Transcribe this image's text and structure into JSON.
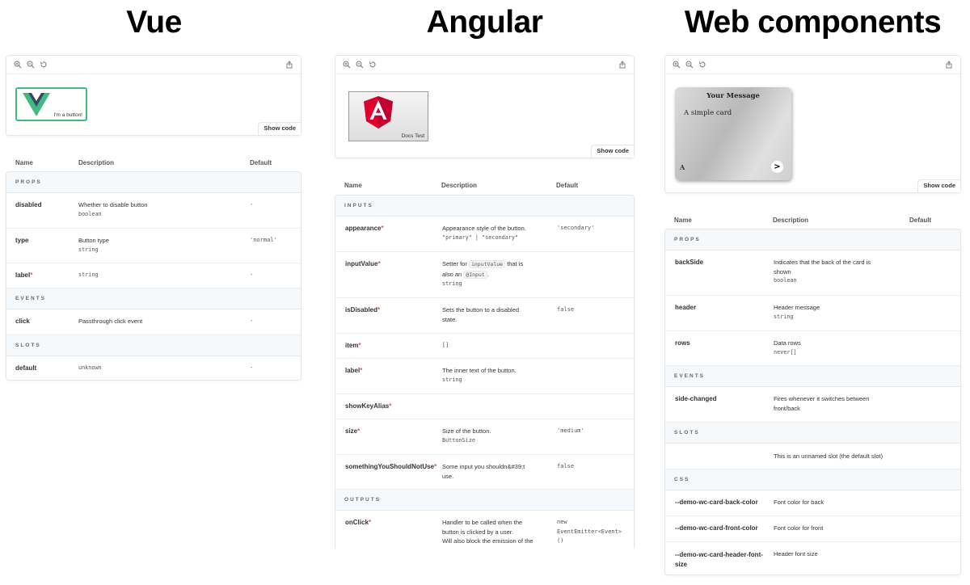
{
  "titles": {
    "vue": "Vue",
    "angular": "Angular",
    "webcomponents": "Web components"
  },
  "toolbar": {
    "icons": [
      "zoom-in-icon",
      "zoom-out-icon",
      "reset-zoom-icon",
      "share-icon"
    ],
    "show_code": "Show code"
  },
  "headers": {
    "name": "Name",
    "description": "Description",
    "default": "Default"
  },
  "vue": {
    "preview_button_text": "I'm a button!",
    "button_border_color": "#42b883",
    "sections": [
      {
        "title": "PROPS",
        "rows": [
          {
            "name": "disabled",
            "required": false,
            "desc": [
              "Whether to disable button"
            ],
            "type": "boolean",
            "default": "-"
          },
          {
            "name": "type",
            "required": false,
            "desc": [
              "Button type"
            ],
            "type": "string",
            "default": "'normal'"
          },
          {
            "name": "label",
            "required": true,
            "desc": [],
            "type": "string",
            "default": "-"
          }
        ]
      },
      {
        "title": "EVENTS",
        "rows": [
          {
            "name": "click",
            "required": false,
            "desc": [
              "Passthrough click event"
            ],
            "type": "",
            "default": "-"
          }
        ]
      },
      {
        "title": "SLOTS",
        "rows": [
          {
            "name": "default",
            "required": false,
            "desc": [],
            "type": "unknown",
            "default": "-"
          }
        ]
      }
    ]
  },
  "angular": {
    "preview_caption": "Docs Test",
    "logo_color": "#dd0031",
    "sections": [
      {
        "title": "INPUTS",
        "rows": [
          {
            "name": "appearance",
            "required": true,
            "desc": [
              "Appearance style of the button."
            ],
            "type": "\"primary\" | \"secondary\"",
            "default": "'secondary'"
          },
          {
            "name": "inputValue",
            "required": true,
            "desc_parts": [
              "Setter for",
              "inputValue",
              "that is",
              "also an",
              "@Input",
              "."
            ],
            "type": "string",
            "default": ""
          },
          {
            "name": "isDisabled",
            "required": true,
            "desc": [
              "Sets the button to a disabled",
              "state."
            ],
            "type": "",
            "default": "false"
          },
          {
            "name": "item",
            "required": true,
            "desc": [],
            "type": "[]",
            "default": ""
          },
          {
            "name": "label",
            "required": true,
            "desc": [
              "The inner text of the button."
            ],
            "type": "string",
            "default": ""
          },
          {
            "name": "showKeyAlias",
            "required": true,
            "desc": [],
            "type": "",
            "default": ""
          },
          {
            "name": "size",
            "required": true,
            "desc": [
              "Size of the button."
            ],
            "type": "ButtonSize",
            "default": "'medium'"
          },
          {
            "name": "somethingYouShouldNotUse",
            "required": true,
            "desc": [
              "Some input you shouldn&#39;t",
              "use."
            ],
            "type": "",
            "default": "false"
          }
        ]
      },
      {
        "title": "OUTPUTS",
        "rows": [
          {
            "name": "onClick",
            "required": true,
            "desc": [
              "Handler to be called when the",
              "button is clicked by a user.",
              "Will also block the emission of the"
            ],
            "type": "",
            "default_lines": [
              "new",
              "EventEmitter<Event>",
              "()"
            ]
          }
        ]
      }
    ]
  },
  "webcomponents": {
    "card_header": "Your Message",
    "card_body": "A simple card",
    "card_footer": "A",
    "card_arrow": ">",
    "sections": [
      {
        "title": "PROPS",
        "rows": [
          {
            "name": "backSide",
            "desc": [
              "Indicates that the back of the card is",
              "shown"
            ],
            "type": "boolean"
          },
          {
            "name": "header",
            "desc": [
              "Header message"
            ],
            "type": "string"
          },
          {
            "name": "rows",
            "desc": [
              "Data rows"
            ],
            "type": "never[]"
          }
        ]
      },
      {
        "title": "EVENTS",
        "rows": [
          {
            "name": "side-changed",
            "desc": [
              "Fires whenever it switches between",
              "front/back"
            ],
            "type": ""
          }
        ]
      },
      {
        "title": "SLOTS",
        "rows": [
          {
            "name": "",
            "desc": [
              "This is an unnamed slot (the default slot)"
            ],
            "type": ""
          }
        ]
      },
      {
        "title": "CSS",
        "rows": [
          {
            "name": "--demo-wc-card-back-color",
            "desc": [
              "Font color for back"
            ],
            "type": ""
          },
          {
            "name": "--demo-wc-card-front-color",
            "desc": [
              "Font color for front"
            ],
            "type": ""
          },
          {
            "name_lines": [
              "--demo-wc-card-header-font-",
              "size"
            ],
            "desc": [
              "Header font size"
            ],
            "type": ""
          }
        ]
      }
    ]
  }
}
